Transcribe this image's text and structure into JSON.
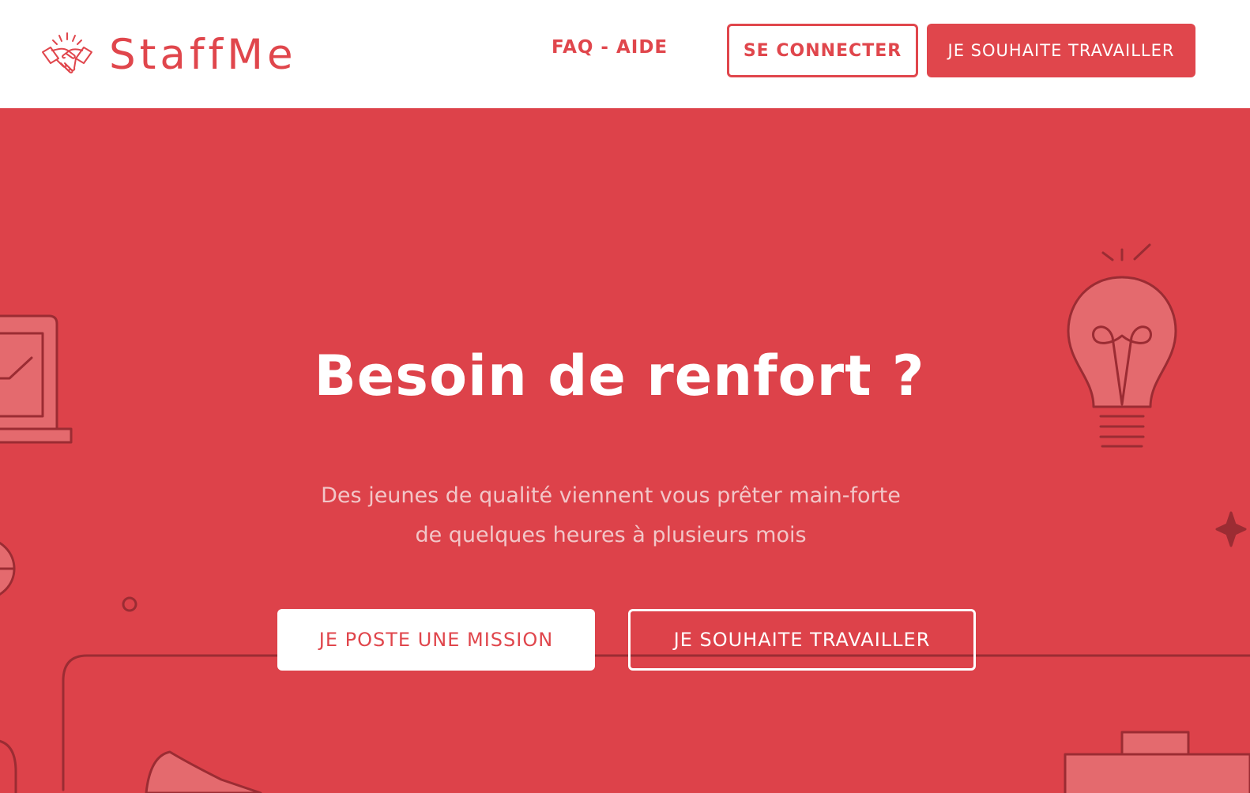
{
  "header": {
    "brand": "StaffMe",
    "nav_faq": "FAQ - AIDE",
    "login_label": "SE CONNECTER",
    "work_label": "JE SOUHAITE TRAVAILLER"
  },
  "hero": {
    "title": "Besoin de renfort ?",
    "subtitle_line1": "Des jeunes de qualité viennent vous prêter main-forte",
    "subtitle_line2": "de quelques heures à plusieurs mois",
    "cta_mission": "JE POSTE UNE MISSION",
    "cta_work": "JE SOUHAITE TRAVAILLER"
  },
  "icons": [
    "handshake-icon",
    "laptop-icon",
    "lightbulb-icon",
    "globe-icon",
    "sparkle-icon",
    "briefcase-icon"
  ],
  "colors": {
    "brand_red": "#e0464c",
    "hero_bg": "#dd424a",
    "line_art": "#9b2c33",
    "white": "#ffffff"
  }
}
